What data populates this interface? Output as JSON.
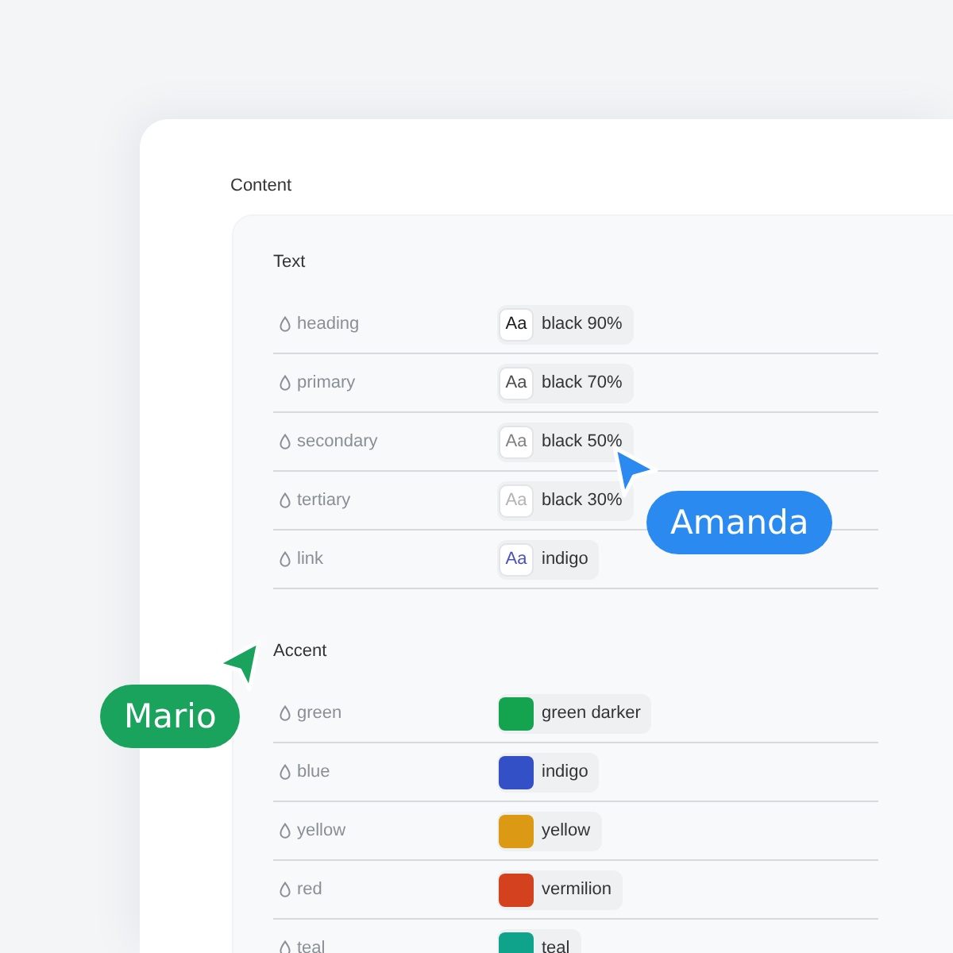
{
  "section_title": "Content",
  "groups": [
    {
      "title": "Text",
      "kind": "sample",
      "tokens": [
        {
          "name": "heading",
          "sample": "Aa",
          "value": "black 90%",
          "color": "#1a1a1a"
        },
        {
          "name": "primary",
          "sample": "Aa",
          "value": "black 70%",
          "color": "#4d4d4d"
        },
        {
          "name": "secondary",
          "sample": "Aa",
          "value": "black 50%",
          "color": "#808080"
        },
        {
          "name": "tertiary",
          "sample": "Aa",
          "value": "black 30%",
          "color": "#b3b3b3"
        },
        {
          "name": "link",
          "sample": "Aa",
          "value": "indigo",
          "color": "#4a52b8"
        }
      ]
    },
    {
      "title": "Accent",
      "kind": "swatch",
      "tokens": [
        {
          "name": "green",
          "value": "green darker",
          "color": "#14a450"
        },
        {
          "name": "blue",
          "value": "indigo",
          "color": "#3350c7"
        },
        {
          "name": "yellow",
          "value": "yellow",
          "color": "#dc9a14"
        },
        {
          "name": "red",
          "value": "vermilion",
          "color": "#d4411f"
        },
        {
          "name": "teal",
          "value": "teal",
          "color": "#10a38c"
        }
      ]
    }
  ],
  "cursors": [
    {
      "name": "Amanda",
      "color": "#2b8af0"
    },
    {
      "name": "Mario",
      "color": "#1aa35c"
    }
  ]
}
